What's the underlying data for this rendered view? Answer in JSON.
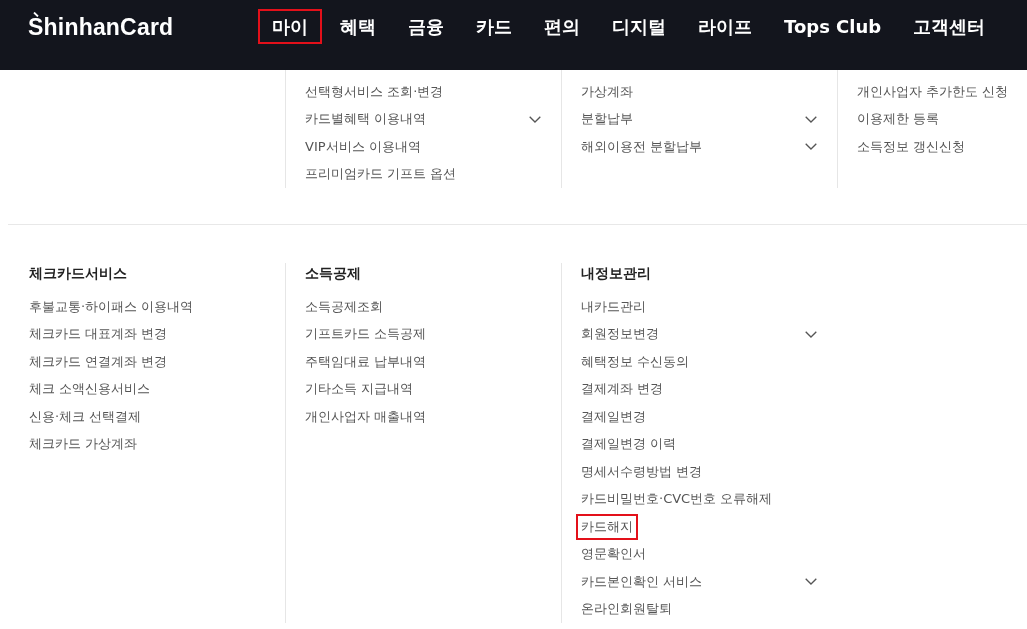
{
  "header": {
    "logo": "ShinhanCard",
    "nav": [
      {
        "label": "마이",
        "selected": true
      },
      {
        "label": "혜택",
        "selected": false
      },
      {
        "label": "금융",
        "selected": false
      },
      {
        "label": "카드",
        "selected": false
      },
      {
        "label": "편의",
        "selected": false
      },
      {
        "label": "디지털",
        "selected": false
      },
      {
        "label": "라이프",
        "selected": false
      },
      {
        "label": "Tops Club",
        "selected": false
      },
      {
        "label": "고객센터",
        "selected": false
      }
    ]
  },
  "menu_top": {
    "columns": [
      {
        "items": [
          {
            "label": "선택형서비스 조회·변경",
            "expandable": false,
            "highlighted": false
          },
          {
            "label": "카드별혜택 이용내역",
            "expandable": true,
            "highlighted": false
          },
          {
            "label": "VIP서비스 이용내역",
            "expandable": false,
            "highlighted": false
          },
          {
            "label": "프리미엄카드 기프트 옵션",
            "expandable": false,
            "highlighted": false
          }
        ]
      },
      {
        "items": [
          {
            "label": "가상계좌",
            "expandable": false,
            "highlighted": false
          },
          {
            "label": "분할납부",
            "expandable": true,
            "highlighted": false
          },
          {
            "label": "해외이용전 분할납부",
            "expandable": true,
            "highlighted": false
          }
        ]
      },
      {
        "items": [
          {
            "label": "개인사업자 추가한도 신청",
            "expandable": false,
            "highlighted": false
          },
          {
            "label": "이용제한 등록",
            "expandable": false,
            "highlighted": false
          },
          {
            "label": "소득정보 갱신신청",
            "expandable": false,
            "highlighted": false
          }
        ]
      }
    ]
  },
  "menu_bottom": {
    "columns": [
      {
        "heading": "체크카드서비스",
        "items": [
          {
            "label": "후불교통·하이패스 이용내역",
            "expandable": false,
            "highlighted": false
          },
          {
            "label": "체크카드 대표계좌 변경",
            "expandable": false,
            "highlighted": false
          },
          {
            "label": "체크카드 연결계좌 변경",
            "expandable": false,
            "highlighted": false
          },
          {
            "label": "체크 소액신용서비스",
            "expandable": false,
            "highlighted": false
          },
          {
            "label": "신용·체크 선택결제",
            "expandable": false,
            "highlighted": false
          },
          {
            "label": "체크카드 가상계좌",
            "expandable": false,
            "highlighted": false
          }
        ]
      },
      {
        "heading": "소득공제",
        "items": [
          {
            "label": "소득공제조회",
            "expandable": false,
            "highlighted": false
          },
          {
            "label": "기프트카드 소득공제",
            "expandable": false,
            "highlighted": false
          },
          {
            "label": "주택임대료 납부내역",
            "expandable": false,
            "highlighted": false
          },
          {
            "label": "기타소득 지급내역",
            "expandable": false,
            "highlighted": false
          },
          {
            "label": "개인사업자 매출내역",
            "expandable": false,
            "highlighted": false
          }
        ]
      },
      {
        "heading": "내정보관리",
        "items": [
          {
            "label": "내카드관리",
            "expandable": false,
            "highlighted": false
          },
          {
            "label": "회원정보변경",
            "expandable": true,
            "highlighted": false
          },
          {
            "label": "혜택정보 수신동의",
            "expandable": false,
            "highlighted": false
          },
          {
            "label": "결제계좌 변경",
            "expandable": false,
            "highlighted": false
          },
          {
            "label": "결제일변경",
            "expandable": false,
            "highlighted": false
          },
          {
            "label": "결제일변경 이력",
            "expandable": false,
            "highlighted": false
          },
          {
            "label": "명세서수령방법 변경",
            "expandable": false,
            "highlighted": false
          },
          {
            "label": "카드비밀번호·CVC번호 오류해제",
            "expandable": false,
            "highlighted": false
          },
          {
            "label": "카드해지",
            "expandable": false,
            "highlighted": true
          },
          {
            "label": "영문확인서",
            "expandable": false,
            "highlighted": false
          },
          {
            "label": "카드본인확인 서비스",
            "expandable": true,
            "highlighted": false
          },
          {
            "label": "온라인회원탈퇴",
            "expandable": false,
            "highlighted": false
          }
        ]
      }
    ]
  }
}
